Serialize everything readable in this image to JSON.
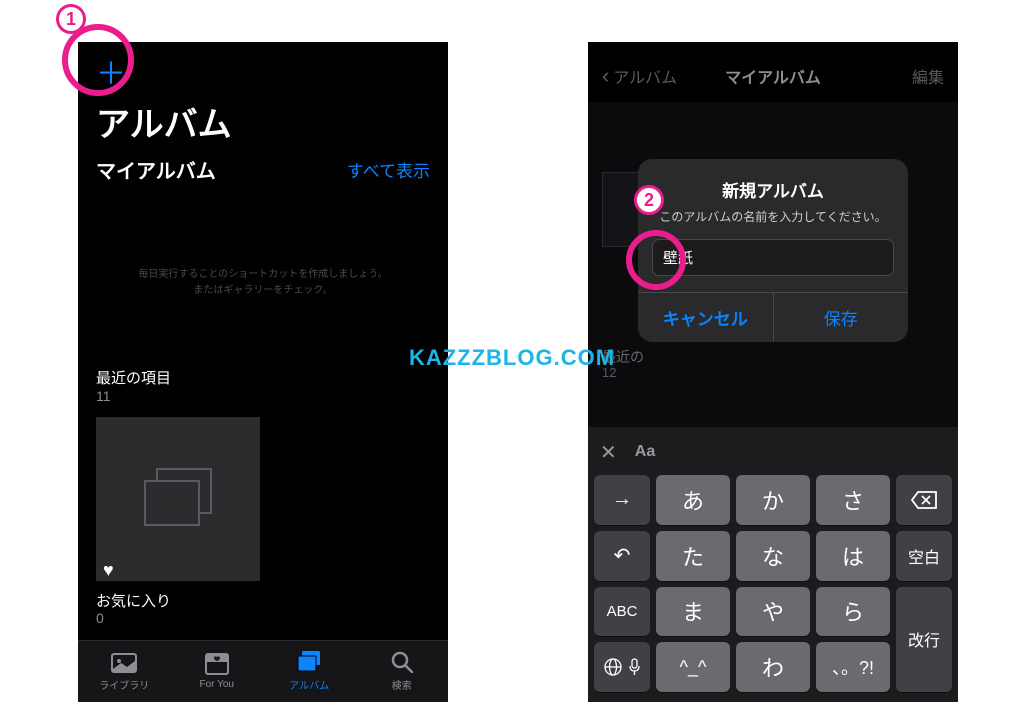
{
  "watermark": "KAZZZBLOG.COM",
  "annotations": {
    "num1": "1",
    "num2": "2"
  },
  "left": {
    "add_label": "＋",
    "title": "アルバム",
    "section": {
      "title": "マイアルバム",
      "see_all": "すべて表示"
    },
    "help_text": "毎日実行することのショートカットを作成しましょう。またはギャラリーをチェック。",
    "recents": {
      "label": "最近の項目",
      "count": "11"
    },
    "favorites": {
      "icon": "♥",
      "label": "お気に入り",
      "count": "0"
    },
    "tabs": [
      {
        "label": "ライブラリ",
        "active": false
      },
      {
        "label": "For You",
        "active": false
      },
      {
        "label": "アルバム",
        "active": true
      },
      {
        "label": "検索",
        "active": false
      }
    ]
  },
  "right": {
    "nav": {
      "back": "アルバム",
      "title": "マイアルバム",
      "edit": "編集"
    },
    "bg": {
      "recents_label": "最近の",
      "recents_count": "12"
    },
    "alert": {
      "title": "新規アルバム",
      "message": "このアルバムの名前を入力してください。",
      "input_value": "壁紙",
      "cancel": "キャンセル",
      "save": "保存"
    },
    "keyboard": {
      "rows": [
        [
          "→",
          "あ",
          "か",
          "さ",
          "⌫"
        ],
        [
          "↶",
          "た",
          "な",
          "は",
          "空白"
        ],
        [
          "ABC",
          "ま",
          "や",
          "ら",
          "改行"
        ],
        [
          "🌐🎤",
          "^_^",
          "わ",
          "、。?!",
          ""
        ]
      ],
      "toolbar": [
        "✕",
        "Aa",
        "⋯"
      ]
    }
  }
}
